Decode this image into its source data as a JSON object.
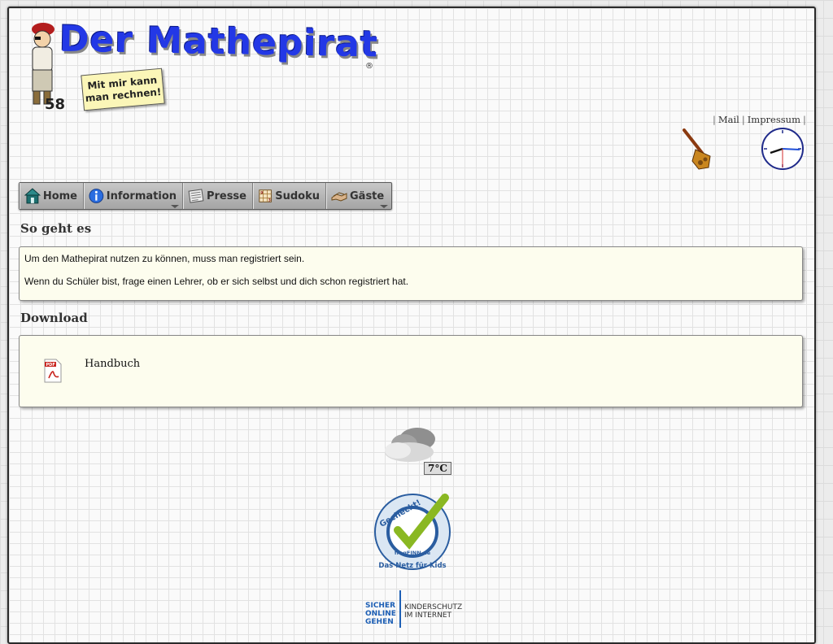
{
  "header": {
    "logo_title": "Der Mathepirat",
    "logo_registered": "®",
    "logo_slogan_line1": "Mit mir kann",
    "logo_slogan_line2": "man rechnen!"
  },
  "top_links": {
    "mail": "Mail",
    "impressum": "Impressum",
    "separator": "|"
  },
  "nav": {
    "items": [
      {
        "label": "Home",
        "icon": "house-icon"
      },
      {
        "label": "Information",
        "icon": "info-icon",
        "has_dropdown": true
      },
      {
        "label": "Presse",
        "icon": "newspaper-icon"
      },
      {
        "label": "Sudoku",
        "icon": "sudoku-icon"
      },
      {
        "label": "Gäste",
        "icon": "guestbook-icon",
        "has_dropdown": true
      }
    ]
  },
  "main": {
    "section1_title": "So geht es",
    "section1_p1": "Um den Mathepirat nutzen zu können, muss man registriert sein.",
    "section1_p2": "Wenn du Schüler bist, frage einen Lehrer, ob er sich selbst und dich schon registriert hat.",
    "section2_title": "Download",
    "download_label": "Handbuch",
    "download_icon": "pdf-icon"
  },
  "widgets": {
    "weather_temp": "7°C",
    "weather_icon": "cloud-icon",
    "badge_top": "Gecheckt!",
    "badge_bottom": "Das Netz für Kids",
    "badge_center": "fragFINN.de",
    "sicher_line1": "SICHER",
    "sicher_line2": "ONLINE",
    "sicher_line3": "GEHEN",
    "kinder_line1": "KINDERSCHUTZ",
    "kinder_line2": "IM INTERNET"
  },
  "colors": {
    "logo_blue": "#2338e6",
    "box_bg": "#fdfdee",
    "nav_bg": "#b4b4b4"
  }
}
